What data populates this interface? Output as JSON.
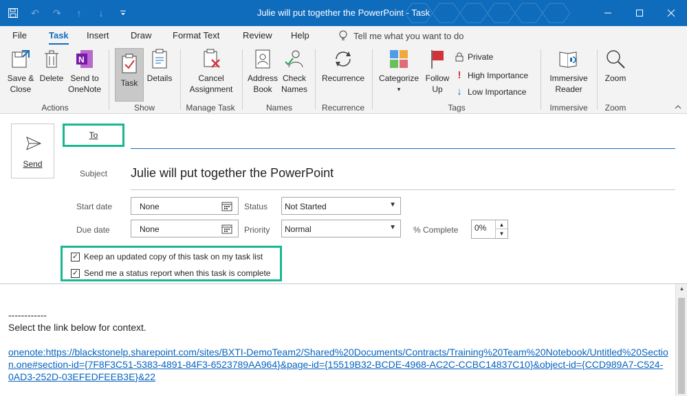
{
  "window": {
    "title": "Julie will put together the PowerPoint  -  Task",
    "qat": [
      "save-icon",
      "undo-icon",
      "redo-icon",
      "up-icon",
      "down-icon",
      "customize-icon"
    ],
    "controls": [
      "minimize",
      "restore",
      "close"
    ]
  },
  "menu": {
    "tabs": [
      "File",
      "Task",
      "Insert",
      "Draw",
      "Format Text",
      "Review",
      "Help"
    ],
    "active": "Task",
    "tell_me": "Tell me what you want to do"
  },
  "ribbon": {
    "actions": {
      "save_close": "Save &\nClose",
      "delete": "Delete",
      "send_onenote": "Send to\nOneNote",
      "group": "Actions"
    },
    "show": {
      "task": "Task",
      "details": "Details",
      "group": "Show"
    },
    "manage": {
      "cancel": "Cancel\nAssignment",
      "group": "Manage Task"
    },
    "names": {
      "address_book": "Address\nBook",
      "check_names": "Check\nNames",
      "group": "Names"
    },
    "recurrence": {
      "recurrence": "Recurrence",
      "group": "Recurrence"
    },
    "tags": {
      "categorize": "Categorize",
      "follow_up": "Follow\nUp",
      "private": "Private",
      "high": "High Importance",
      "low": "Low Importance",
      "group": "Tags"
    },
    "immersive": {
      "reader": "Immersive\nReader",
      "group": "Immersive"
    },
    "zoom": {
      "zoom": "Zoom",
      "group": "Zoom"
    }
  },
  "form": {
    "send": "Send",
    "to": "To",
    "subject_label": "Subject",
    "subject": "Julie will put together the PowerPoint",
    "start_date_label": "Start date",
    "start_date": "None",
    "due_date_label": "Due date",
    "due_date": "None",
    "status_label": "Status",
    "status": "Not Started",
    "priority_label": "Priority",
    "priority": "Normal",
    "complete_label": "% Complete",
    "complete": "0%",
    "keep_copy": "Keep an updated copy of this task on my task list",
    "keep_copy_checked": true,
    "status_report": "Send me a status report when this task is complete",
    "status_report_checked": true
  },
  "body": {
    "dashes": "------------",
    "intro": "Select the link below for context.",
    "link": "onenote:https://blackstonelp.sharepoint.com/sites/BXTI-DemoTeam2/Shared%20Documents/Contracts/Training%20Team%20Notebook/Untitled%20Section.one#section-id={7F8F3C51-5383-4891-84F3-6523789AA964}&page-id={15519B32-BCDE-4968-AC2C-CCBC14837C10}&object-id={CCD989A7-C524-0AD3-252D-03EFEDFEEB3E}&22"
  },
  "colors": {
    "brand": "#0f6cbd",
    "highlight": "#17b890"
  }
}
